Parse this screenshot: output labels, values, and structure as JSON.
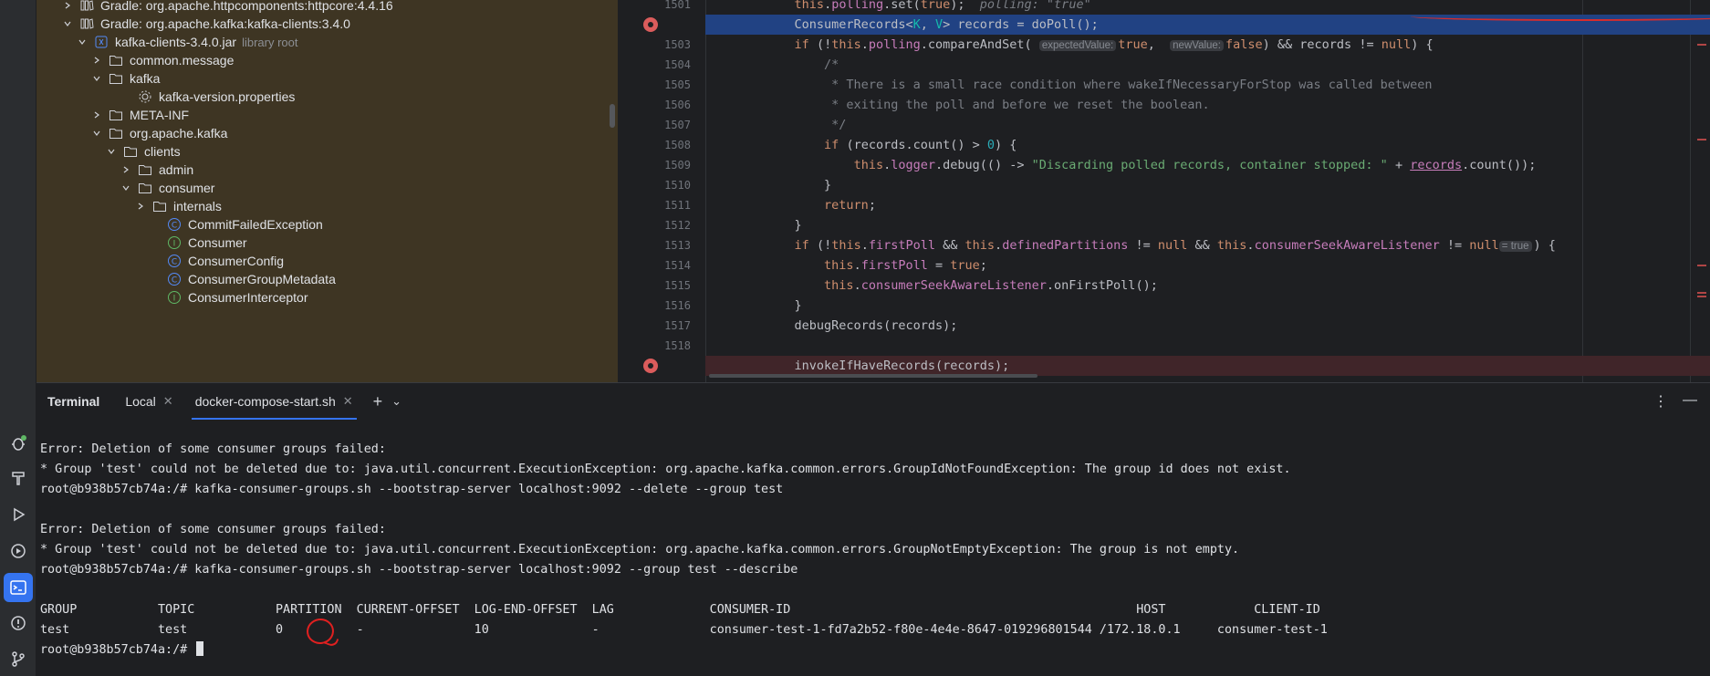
{
  "project_tree": {
    "items": [
      {
        "label": "Gradle: org.apache.httpcomponents:httpcore:4.4.16",
        "hint": "",
        "icon": "library-icon",
        "expanded": false
      },
      {
        "label": "Gradle: org.apache.kafka:kafka-clients:3.4.0",
        "hint": "",
        "icon": "library-icon",
        "expanded": true
      },
      {
        "label": "kafka-clients-3.4.0.jar",
        "hint": "library root",
        "icon": "jar-icon",
        "expanded": true
      },
      {
        "label": "common.message",
        "hint": "",
        "icon": "folder-icon",
        "expanded": false
      },
      {
        "label": "kafka",
        "hint": "",
        "icon": "folder-icon",
        "expanded": true
      },
      {
        "label": "kafka-version.properties",
        "hint": "",
        "icon": "properties-file-icon",
        "expanded": null
      },
      {
        "label": "META-INF",
        "hint": "",
        "icon": "folder-icon",
        "expanded": false
      },
      {
        "label": "org.apache.kafka",
        "hint": "",
        "icon": "folder-icon",
        "expanded": true
      },
      {
        "label": "clients",
        "hint": "",
        "icon": "folder-icon",
        "expanded": true
      },
      {
        "label": "admin",
        "hint": "",
        "icon": "folder-icon",
        "expanded": false
      },
      {
        "label": "consumer",
        "hint": "",
        "icon": "folder-icon",
        "expanded": true
      },
      {
        "label": "internals",
        "hint": "",
        "icon": "folder-icon",
        "expanded": false
      },
      {
        "label": "CommitFailedException",
        "hint": "",
        "icon": "class-icon",
        "expanded": null
      },
      {
        "label": "Consumer",
        "hint": "",
        "icon": "interface-icon",
        "expanded": null
      },
      {
        "label": "ConsumerConfig",
        "hint": "",
        "icon": "class-icon",
        "expanded": null
      },
      {
        "label": "ConsumerGroupMetadata",
        "hint": "",
        "icon": "class-icon",
        "expanded": null
      },
      {
        "label": "ConsumerInterceptor",
        "hint": "",
        "icon": "interface-icon",
        "expanded": null
      }
    ]
  },
  "editor": {
    "line_numbers": [
      "1501",
      "",
      "1503",
      "1504",
      "1505",
      "1506",
      "1507",
      "1508",
      "1509",
      "1510",
      "1511",
      "1512",
      "1513",
      "1514",
      "1515",
      "1516",
      "1517",
      "1518",
      ""
    ],
    "inline_hints": {
      "expected_value": "expectedValue:",
      "new_value": "newValue:",
      "eq_true": "= true",
      "polling_debug": "polling: \"true\""
    }
  },
  "terminal": {
    "title": "Terminal",
    "tabs": [
      {
        "label": "Local",
        "active": false
      },
      {
        "label": "docker-compose-start.sh",
        "active": true
      }
    ],
    "lines": [
      "Error: Deletion of some consumer groups failed:",
      "* Group 'test' could not be deleted due to: java.util.concurrent.ExecutionException: org.apache.kafka.common.errors.GroupIdNotFoundException: The group id does not exist.",
      "root@b938b57cb74a:/# kafka-consumer-groups.sh --bootstrap-server localhost:9092 --delete --group test",
      "",
      "Error: Deletion of some consumer groups failed:",
      "* Group 'test' could not be deleted due to: java.util.concurrent.ExecutionException: org.apache.kafka.common.errors.GroupNotEmptyException: The group is not empty.",
      "root@b938b57cb74a:/# kafka-consumer-groups.sh --bootstrap-server localhost:9092 --group test --describe",
      "",
      "GROUP           TOPIC           PARTITION  CURRENT-OFFSET  LOG-END-OFFSET  LAG             CONSUMER-ID                                               HOST            CLIENT-ID",
      "test            test            0          -               10              -               consumer-test-1-fd7a2b52-f80e-4e4e-8647-019296801544 /172.18.0.1     consumer-test-1"
    ],
    "prompt": "root@b938b57cb74a:/#"
  },
  "colors": {
    "accent": "#3574f0",
    "breakpoint": "#db5c5c",
    "annotation_red": "#e02020"
  }
}
